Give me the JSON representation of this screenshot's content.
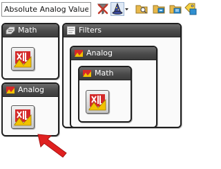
{
  "toolbar": {
    "search_value": "Absolute Analog Value",
    "buttons": [
      {
        "name": "clear-filter-icon",
        "color": "#c0392b"
      },
      {
        "name": "wizard-hat-icon",
        "color": "#3a4a9e"
      },
      {
        "name": "folder-search-icon",
        "color": "#e8b84a"
      },
      {
        "name": "folder-network-icon",
        "color": "#2f8fd0"
      },
      {
        "name": "folder-list-icon",
        "color": "#2f8fd0"
      },
      {
        "name": "tag-search-icon",
        "color": "#2f8fd0"
      }
    ]
  },
  "panels": {
    "math_top": {
      "title": "Math"
    },
    "analog_left": {
      "title": "Analog"
    },
    "filters": {
      "title": "Filters"
    },
    "analog_nested": {
      "title": "Analog"
    },
    "math_nested": {
      "title": "Math"
    }
  },
  "colors": {
    "header_bg": "#4a4a4a",
    "border": "#1e1e1e",
    "icon_red": "#d42a2a",
    "icon_yellow": "#f2c200",
    "arrow_red": "#e0201f"
  }
}
